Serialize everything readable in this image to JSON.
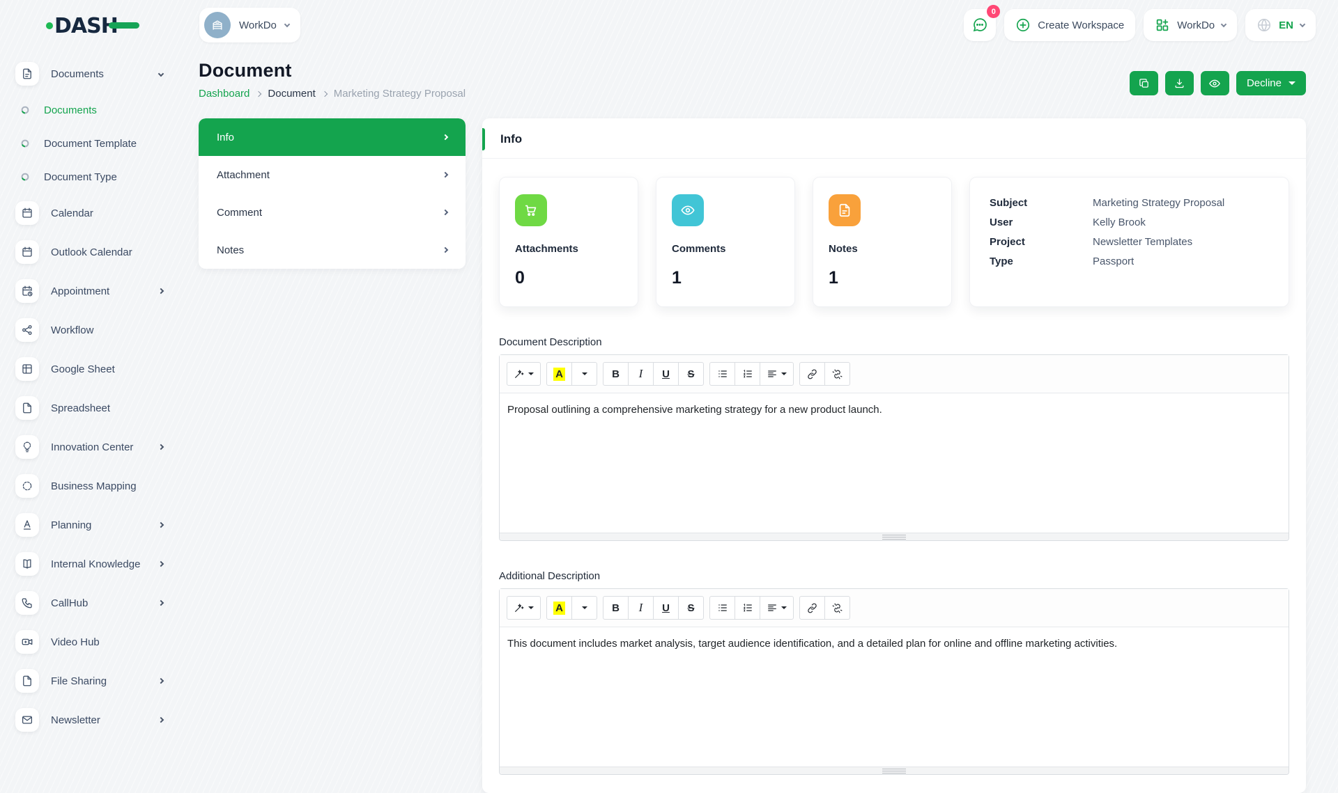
{
  "brand": {
    "name": "DASH"
  },
  "topbar": {
    "workspace_selector": {
      "label": "WorkDo"
    },
    "messages_badge": "0",
    "create_workspace_label": "Create Workspace",
    "workdo_menu_label": "WorkDo",
    "language": "EN"
  },
  "sidebar": {
    "items": [
      {
        "label": "Documents",
        "icon": "document-icon",
        "expanded": true
      },
      {
        "label": "Documents",
        "icon": "progress-ring-icon",
        "sub": true,
        "active": true
      },
      {
        "label": "Document Template",
        "icon": "progress-ring-icon",
        "sub": true
      },
      {
        "label": "Document Type",
        "icon": "progress-ring-icon",
        "sub": true
      },
      {
        "label": "Calendar",
        "icon": "calendar-icon"
      },
      {
        "label": "Outlook Calendar",
        "icon": "calendar-icon"
      },
      {
        "label": "Appointment",
        "icon": "calendar-clock-icon",
        "chevron": true
      },
      {
        "label": "Workflow",
        "icon": "workflow-icon"
      },
      {
        "label": "Google Sheet",
        "icon": "table-icon"
      },
      {
        "label": "Spreadsheet",
        "icon": "file-icon"
      },
      {
        "label": "Innovation Center",
        "icon": "lightbulb-icon",
        "chevron": true
      },
      {
        "label": "Business Mapping",
        "icon": "dashed-circle-icon"
      },
      {
        "label": "Planning",
        "icon": "letter-a-icon",
        "chevron": true
      },
      {
        "label": "Internal Knowledge",
        "icon": "book-icon",
        "chevron": true
      },
      {
        "label": "CallHub",
        "icon": "phone-icon",
        "chevron": true
      },
      {
        "label": "Video Hub",
        "icon": "video-camera-icon"
      },
      {
        "label": "File Sharing",
        "icon": "file-icon",
        "chevron": true
      },
      {
        "label": "Newsletter",
        "icon": "mail-icon",
        "chevron": true
      }
    ]
  },
  "page": {
    "title": "Document",
    "breadcrumb": {
      "home": "Dashboard",
      "section": "Document",
      "current": "Marketing Strategy Proposal"
    },
    "actions": {
      "decline_label": "Decline"
    }
  },
  "tab_menu": [
    {
      "label": "Info",
      "active": true
    },
    {
      "label": "Attachment"
    },
    {
      "label": "Comment"
    },
    {
      "label": "Notes"
    }
  ],
  "info": {
    "title": "Info",
    "stats": [
      {
        "label": "Attachments",
        "value": "0",
        "color": "#6fd944",
        "icon": "cart-icon"
      },
      {
        "label": "Comments",
        "value": "1",
        "color": "#41c5d6",
        "icon": "eye-icon"
      },
      {
        "label": "Notes",
        "value": "1",
        "color": "#f9a13b",
        "icon": "note-file-icon"
      }
    ],
    "details": [
      {
        "label": "Subject",
        "value": "Marketing Strategy Proposal"
      },
      {
        "label": "User",
        "value": "Kelly Brook"
      },
      {
        "label": "Project",
        "value": "Newsletter Templates"
      },
      {
        "label": "Type",
        "value": "Passport"
      }
    ],
    "document_description": {
      "label": "Document Description",
      "content": "Proposal outlining a comprehensive marketing strategy for a new product launch."
    },
    "additional_description": {
      "label": "Additional Description",
      "content": "This document includes market analysis, target audience identification, and a detailed plan for online and offline marketing activities."
    }
  },
  "toolbar_glyphs": {
    "bold": "B",
    "italic": "I",
    "underline": "U",
    "strike": "S",
    "color": "A"
  },
  "colors": {
    "primary_green": "#14a44e",
    "stat_green": "#6fd944",
    "stat_teal": "#41c5d6",
    "stat_orange": "#f9a13b",
    "badge_pink": "#ff4775"
  },
  "icons": {
    "used": [
      "chat-bubble-icon",
      "plus-circle-icon",
      "grid-plus-icon",
      "globe-icon",
      "copy-icon",
      "download-icon",
      "eye-icon",
      "magic-wand-icon",
      "font-color-icon",
      "unordered-list-icon",
      "ordered-list-icon",
      "paragraph-align-icon",
      "link-icon",
      "unlink-icon",
      "chevron-icons"
    ]
  }
}
